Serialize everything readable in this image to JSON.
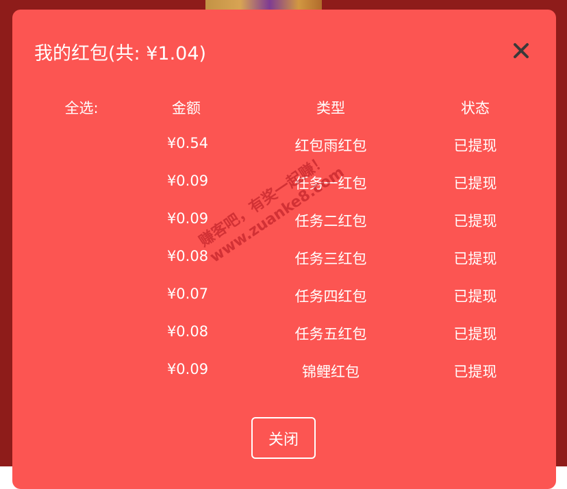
{
  "modal": {
    "title": "我的红包(共: ¥1.04)",
    "close_icon": "close-icon"
  },
  "table": {
    "headers": {
      "select_all": "全选:",
      "amount": "金额",
      "type": "类型",
      "status": "状态"
    },
    "rows": [
      {
        "amount": "¥0.54",
        "type": "红包雨红包",
        "status": "已提现"
      },
      {
        "amount": "¥0.09",
        "type": "任务一红包",
        "status": "已提现"
      },
      {
        "amount": "¥0.09",
        "type": "任务二红包",
        "status": "已提现"
      },
      {
        "amount": "¥0.08",
        "type": "任务三红包",
        "status": "已提现"
      },
      {
        "amount": "¥0.07",
        "type": "任务四红包",
        "status": "已提现"
      },
      {
        "amount": "¥0.08",
        "type": "任务五红包",
        "status": "已提现"
      },
      {
        "amount": "¥0.09",
        "type": "锦鲤红包",
        "status": "已提现"
      }
    ]
  },
  "watermark": {
    "line1": "赚客吧，有奖一起赚！",
    "line2": "www.zuanke8.com"
  },
  "footer": {
    "close_label": "关闭"
  },
  "colors": {
    "modal_bg": "#fc5552",
    "backdrop": "#8e1c1a",
    "text": "#ffffff"
  }
}
